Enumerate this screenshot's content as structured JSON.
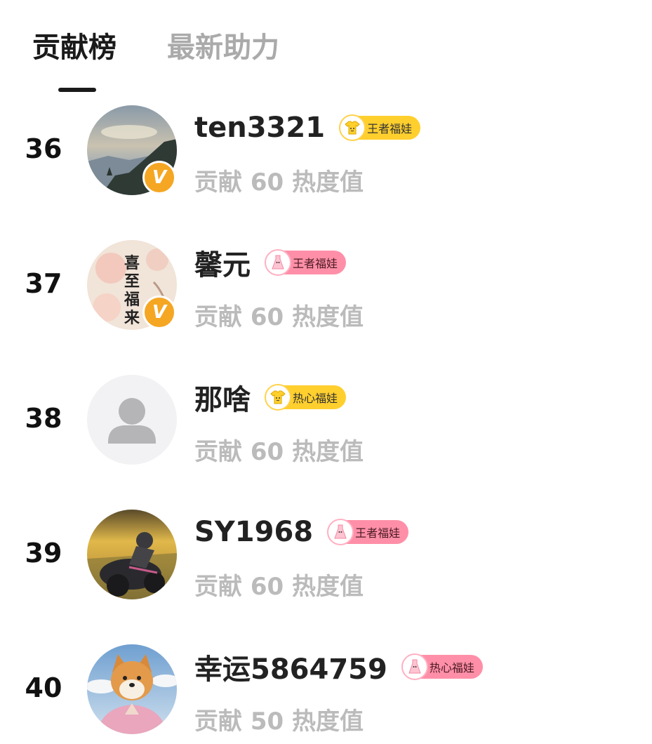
{
  "tabs": {
    "active_label": "贡献榜",
    "inactive_label": "最新助力"
  },
  "rows": [
    {
      "rank": "36",
      "name": "ten3321",
      "badge": "王者福娃",
      "badge_color": "#ffcf2e",
      "badge_icon": "tshirt-icon",
      "contribution": "贡献 60 热度值",
      "verified": true
    },
    {
      "rank": "37",
      "name": "馨元",
      "badge": "王者福娃",
      "badge_color": "#ff8fa8",
      "badge_icon": "dress-icon",
      "contribution": "贡献 60 热度值",
      "verified": true,
      "avatar_text": "喜至福来"
    },
    {
      "rank": "38",
      "name": "那啥",
      "badge": "热心福娃",
      "badge_color": "#ffcf2e",
      "badge_icon": "tshirt-icon",
      "contribution": "贡献 60 热度值",
      "verified": false
    },
    {
      "rank": "39",
      "name": "SY1968",
      "badge": "王者福娃",
      "badge_color": "#ff8fa8",
      "badge_icon": "dress-icon",
      "contribution": "贡献 60 热度值",
      "verified": false
    },
    {
      "rank": "40",
      "name": "幸运5864759",
      "badge": "热心福娃",
      "badge_color": "#ff8fa8",
      "badge_icon": "dress-icon",
      "contribution": "贡献 50 热度值",
      "verified": false
    }
  ],
  "verified_mark": "V"
}
